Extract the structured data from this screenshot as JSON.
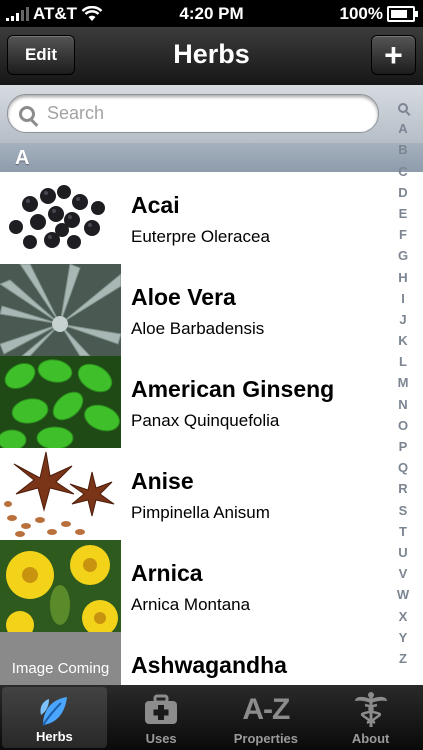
{
  "status": {
    "carrier": "AT&T",
    "time": "4:20 PM",
    "battery": "100%"
  },
  "nav": {
    "edit_label": "Edit",
    "title": "Herbs",
    "add_label": "+"
  },
  "search": {
    "placeholder": "Search"
  },
  "section_letter": "A",
  "herbs": [
    {
      "name": "Acai",
      "scientific": "Euterpre Oleracea"
    },
    {
      "name": "Aloe Vera",
      "scientific": "Aloe Barbadensis"
    },
    {
      "name": "American Ginseng",
      "scientific": "Panax Quinquefolia"
    },
    {
      "name": "Anise",
      "scientific": "Pimpinella Anisum"
    },
    {
      "name": "Arnica",
      "scientific": "Arnica Montana"
    },
    {
      "name": "Ashwagandha",
      "scientific": "",
      "placeholder_text": "Image Coming"
    }
  ],
  "index_letters": [
    "A",
    "B",
    "C",
    "D",
    "E",
    "F",
    "G",
    "H",
    "I",
    "J",
    "K",
    "L",
    "M",
    "N",
    "O",
    "P",
    "Q",
    "R",
    "S",
    "T",
    "U",
    "V",
    "W",
    "X",
    "Y",
    "Z"
  ],
  "tabs": [
    {
      "label": "Herbs",
      "icon": "leaf-icon",
      "active": true
    },
    {
      "label": "Uses",
      "icon": "medical-kit-icon",
      "active": false
    },
    {
      "label": "Properties",
      "icon": "a-z-icon",
      "icon_text": "A-Z",
      "active": false
    },
    {
      "label": "About",
      "icon": "caduceus-icon",
      "active": false
    }
  ],
  "colors": {
    "nav_bg": "#2a2a2a",
    "section_bg": "#98a5b4",
    "index_text": "#7c8692"
  }
}
